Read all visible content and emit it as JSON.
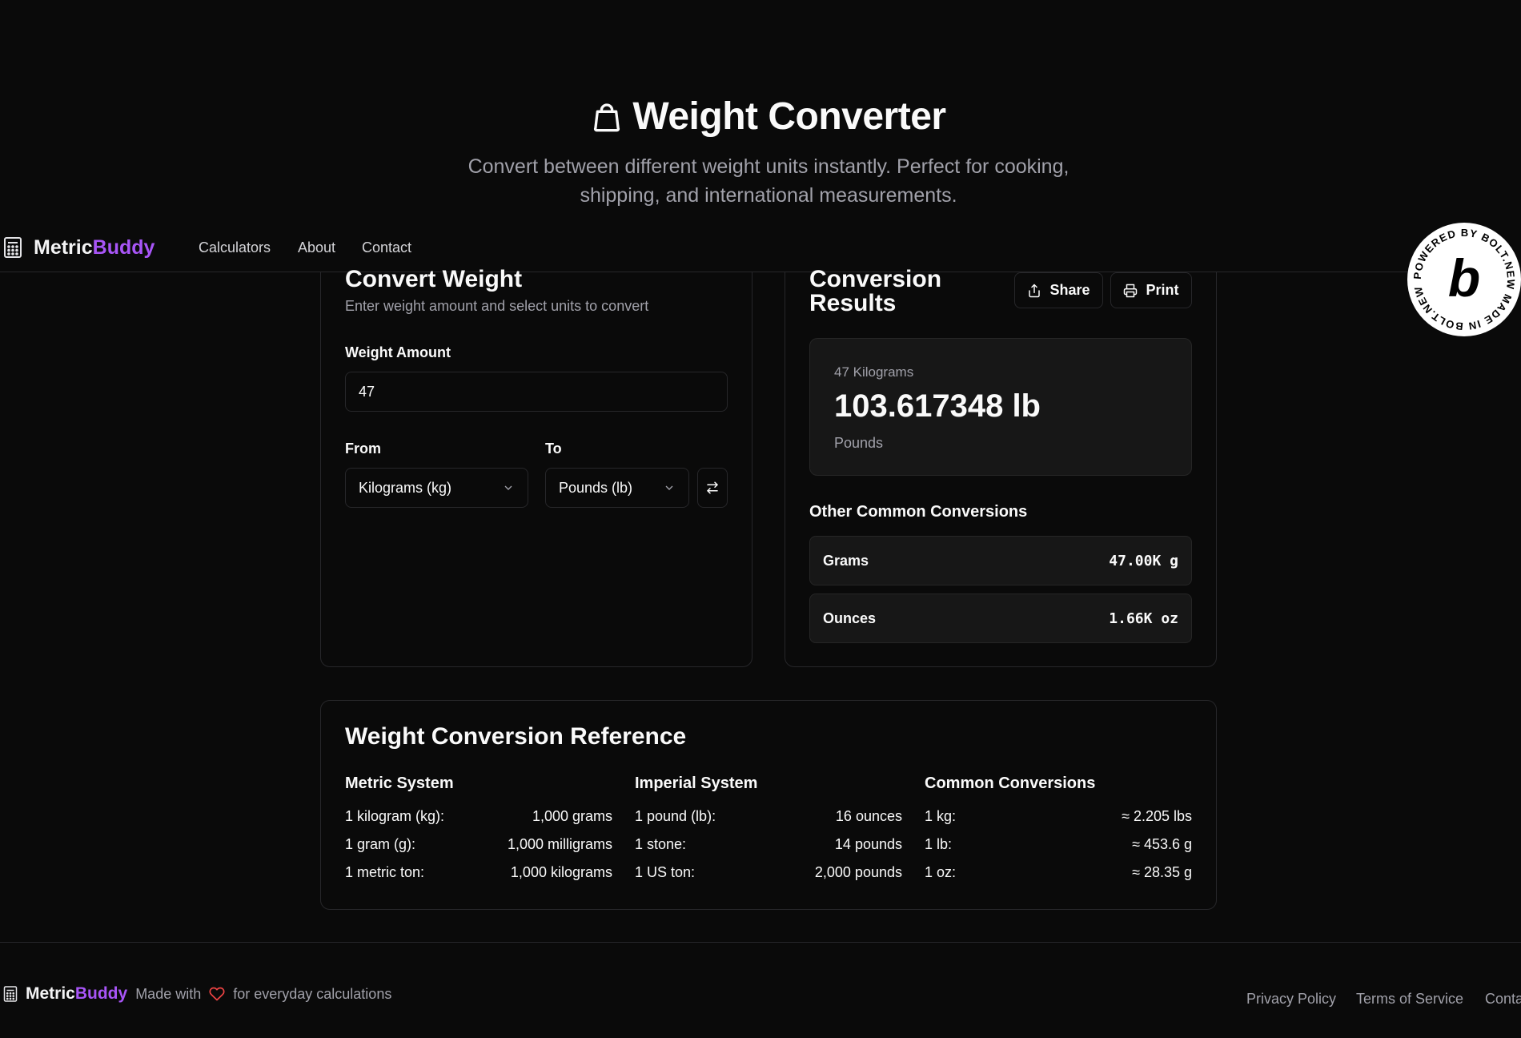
{
  "hero": {
    "title": "Weight Converter",
    "subtitle": "Convert between different weight units instantly. Perfect for cooking, shipping, and international measurements."
  },
  "nav": {
    "brand_metric": "Metric",
    "brand_buddy": "Buddy",
    "links": [
      "Calculators",
      "About",
      "Contact"
    ]
  },
  "converter": {
    "title": "Convert Weight",
    "description": "Enter weight amount and select units to convert",
    "amount_label": "Weight Amount",
    "amount_value": "47",
    "from_label": "From",
    "from_value": "Kilograms (kg)",
    "to_label": "To",
    "to_value": "Pounds (lb)"
  },
  "results": {
    "title_line1": "Conversion",
    "title_line2": "Results",
    "share_label": "Share",
    "print_label": "Print",
    "input_caption": "47 Kilograms",
    "result_value": "103.617348 lb",
    "result_unit": "Pounds",
    "other_title": "Other Common Conversions",
    "other": [
      {
        "name": "Grams",
        "value": "47.00K g"
      },
      {
        "name": "Ounces",
        "value": "1.66K oz"
      }
    ]
  },
  "reference": {
    "title": "Weight Conversion Reference",
    "columns": [
      {
        "heading": "Metric System",
        "rows": [
          {
            "k": "1 kilogram (kg):",
            "v": "1,000 grams"
          },
          {
            "k": "1 gram (g):",
            "v": "1,000 milligrams"
          },
          {
            "k": "1 metric ton:",
            "v": "1,000 kilograms"
          }
        ]
      },
      {
        "heading": "Imperial System",
        "rows": [
          {
            "k": "1 pound (lb):",
            "v": "16 ounces"
          },
          {
            "k": "1 stone:",
            "v": "14 pounds"
          },
          {
            "k": "1 US ton:",
            "v": "2,000 pounds"
          }
        ]
      },
      {
        "heading": "Common Conversions",
        "rows": [
          {
            "k": "1 kg:",
            "v": "≈ 2.205 lbs"
          },
          {
            "k": "1 lb:",
            "v": "≈ 453.6 g"
          },
          {
            "k": "1 oz:",
            "v": "≈ 28.35 g"
          }
        ]
      }
    ]
  },
  "footer": {
    "brand_metric": "Metric",
    "brand_buddy": "Buddy",
    "made_with": "Made with",
    "tagline": "for everyday calculations",
    "links": [
      "Privacy Policy",
      "Terms of Service",
      "Conta"
    ]
  },
  "badge": {
    "ring_text": "POWERED BY BOLT.NEW MADE IN BOLT.NEW",
    "letter": "b"
  },
  "colors": {
    "background": "#0a0a0a",
    "accent": "#a855f7",
    "heart": "#ef4444",
    "border": "#27272a"
  }
}
